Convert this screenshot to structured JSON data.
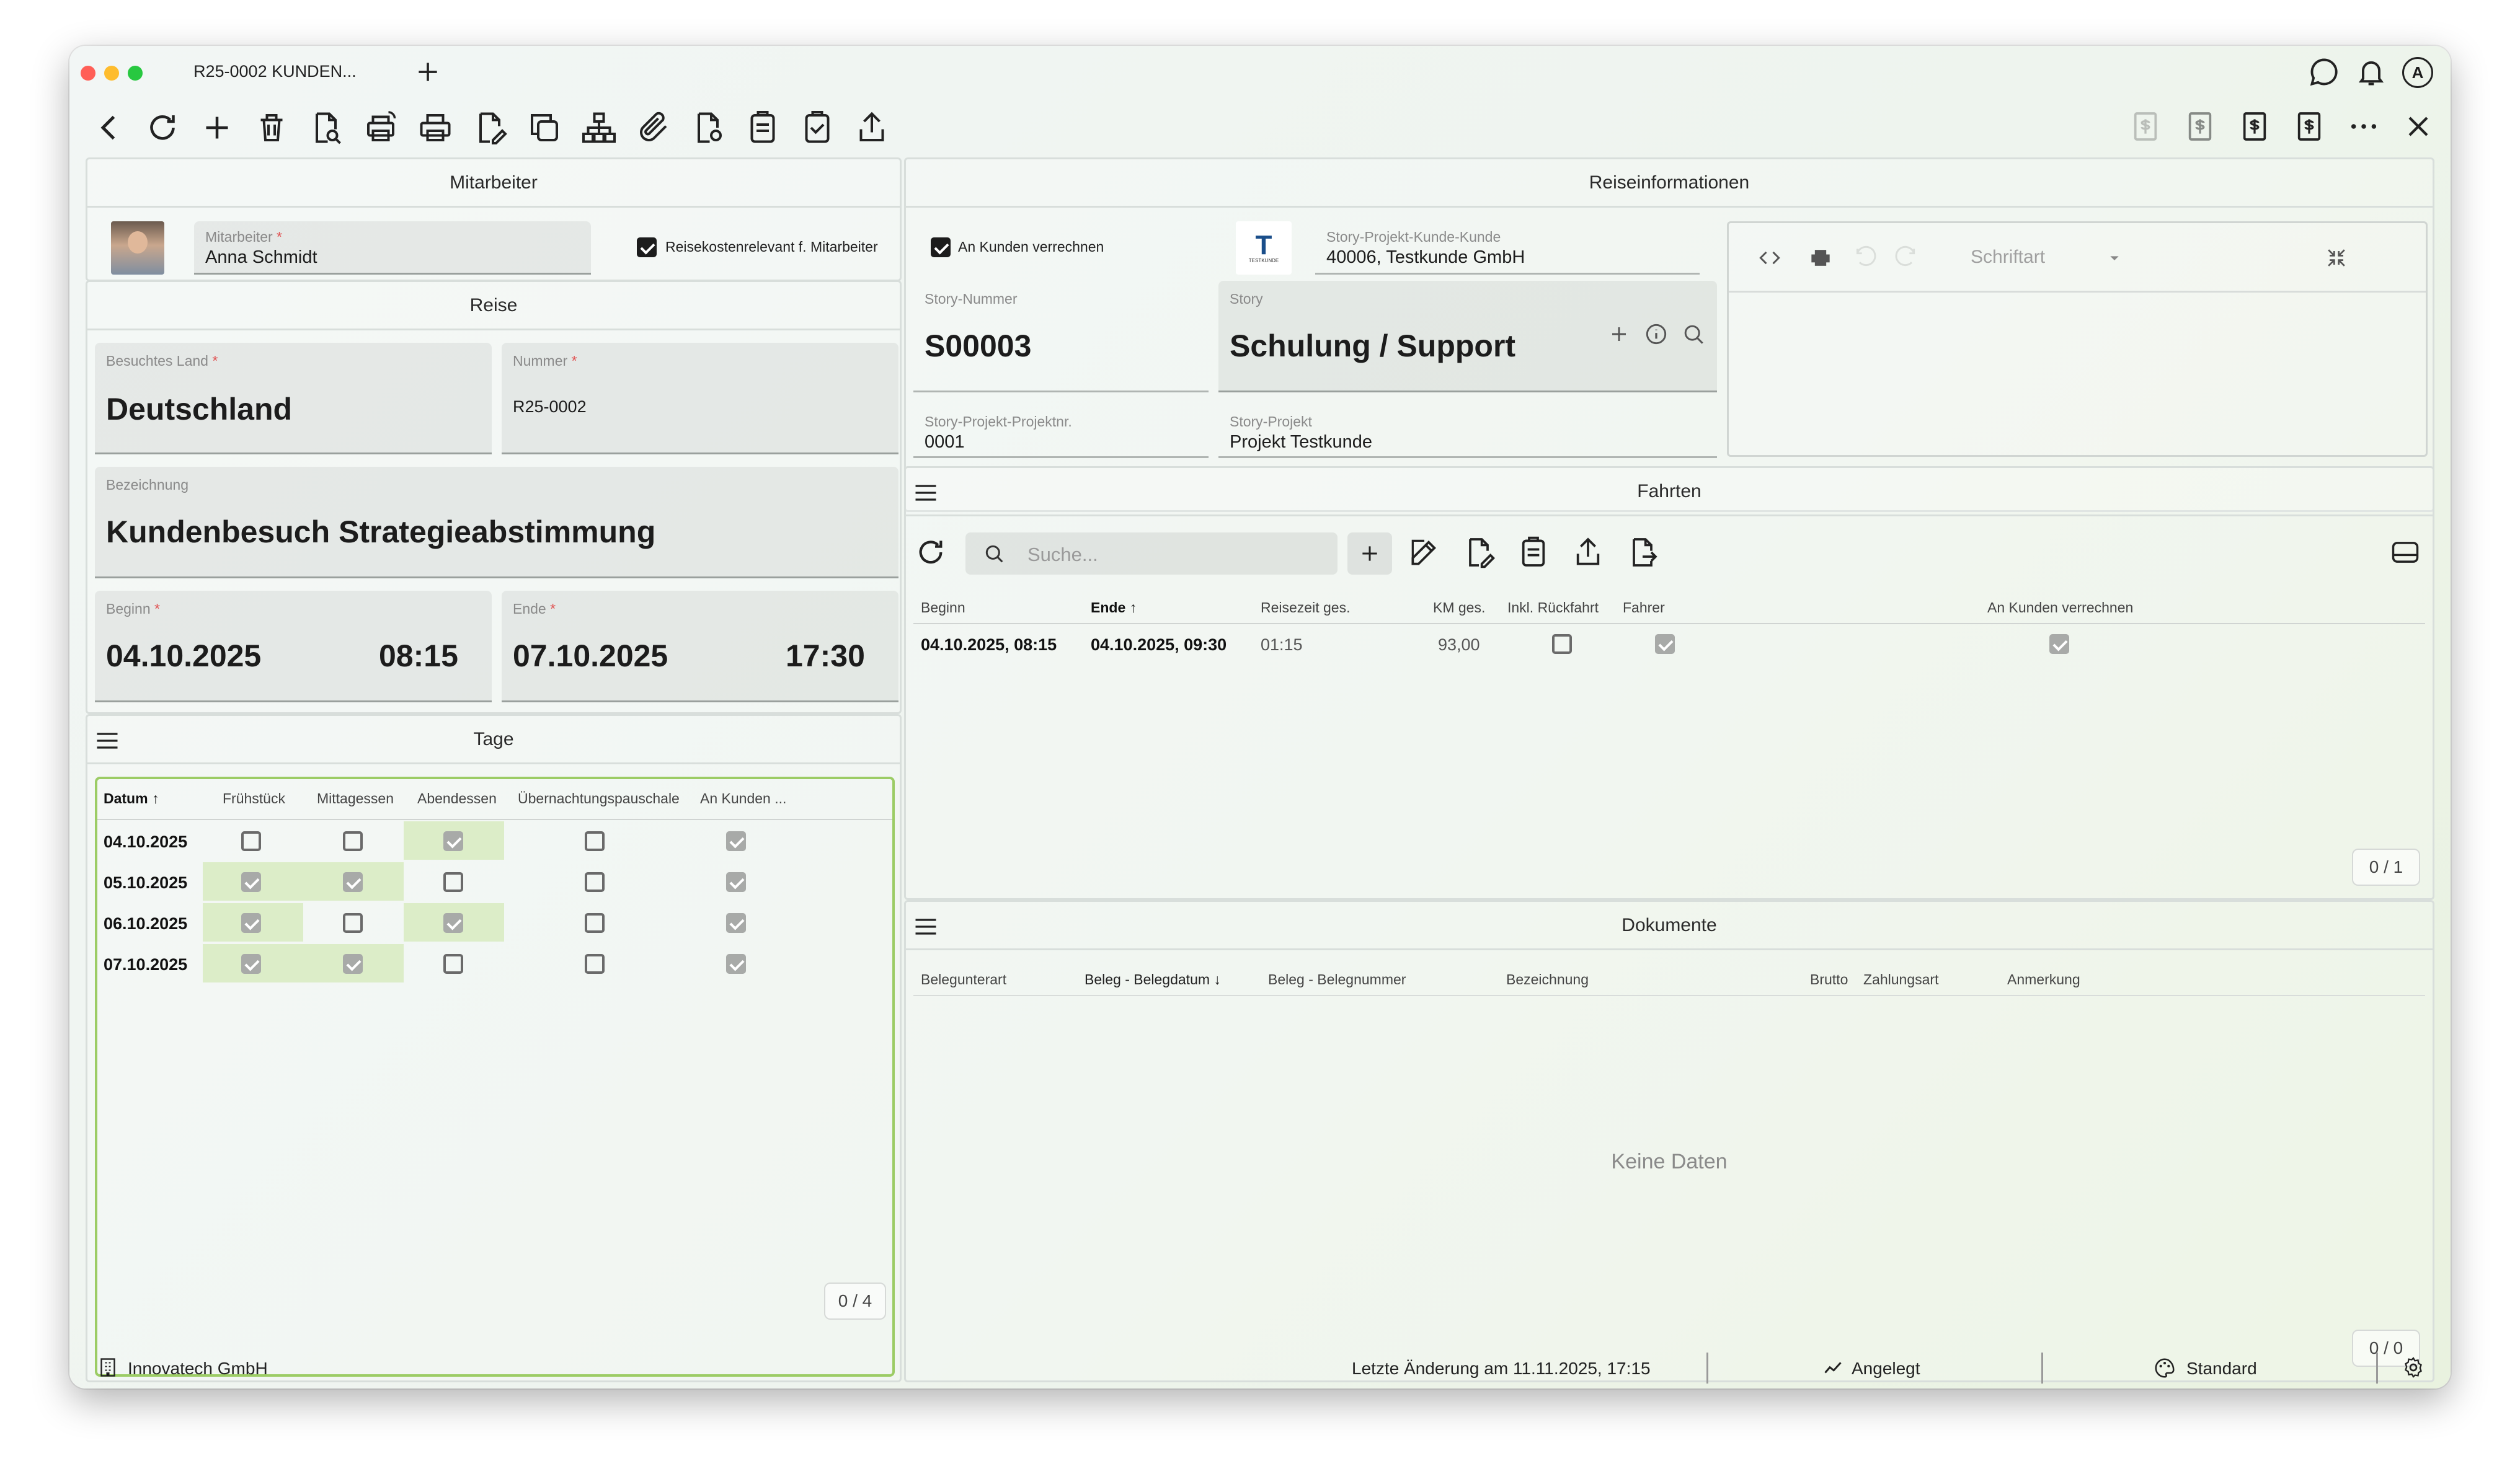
{
  "window": {
    "tab_title": "R25-0002 KUNDEN...",
    "avatar_letter": "A"
  },
  "mitarbeiter": {
    "title": "Mitarbeiter",
    "label": "Mitarbeiter",
    "required_mark": "*",
    "value": "Anna Schmidt",
    "checkbox_label": "Reisekostenrelevant f. Mitarbeiter",
    "checkbox_checked": true
  },
  "reise": {
    "title": "Reise",
    "land_label": "Besuchtes Land",
    "land_value": "Deutschland",
    "nummer_label": "Nummer",
    "nummer_value": "R25-0002",
    "bezeichnung_label": "Bezeichnung",
    "bezeichnung_value": "Kundenbesuch Strategieabstimmung",
    "beginn_label": "Beginn",
    "beginn_date": "04.10.2025",
    "beginn_time": "08:15",
    "ende_label": "Ende",
    "ende_date": "07.10.2025",
    "ende_time": "17:30",
    "required_mark": "*"
  },
  "tage": {
    "title": "Tage",
    "headers": [
      "Datum",
      "Frühstück",
      "Mittagessen",
      "Abendessen",
      "Übernachtungspauschale",
      "An Kunden ..."
    ],
    "sort_arrow": "↑",
    "rows": [
      {
        "datum": "04.10.2025",
        "fruehstueck": false,
        "mittag": false,
        "abend": true,
        "uebernacht": false,
        "kunden": true
      },
      {
        "datum": "05.10.2025",
        "fruehstueck": true,
        "mittag": true,
        "abend": false,
        "uebernacht": false,
        "kunden": true
      },
      {
        "datum": "06.10.2025",
        "fruehstueck": true,
        "mittag": false,
        "abend": true,
        "uebernacht": false,
        "kunden": true
      },
      {
        "datum": "07.10.2025",
        "fruehstueck": true,
        "mittag": true,
        "abend": false,
        "uebernacht": false,
        "kunden": true
      }
    ],
    "pager": "0 / 4"
  },
  "reiseinfo": {
    "title": "Reiseinformationen",
    "verrechnen_label": "An Kunden verrechnen",
    "verrechnen_checked": true,
    "kunde_label": "Story-Projekt-Kunde-Kunde",
    "kunde_value": "40006, Testkunde GmbH",
    "logo_text": "TESTKUNDE",
    "story_nr_label": "Story-Nummer",
    "story_nr_value": "S00003",
    "story_label": "Story",
    "story_value": "Schulung / Support",
    "projektnr_label": "Story-Projekt-Projektnr.",
    "projektnr_value": "0001",
    "projekt_label": "Story-Projekt",
    "projekt_value": "Projekt Testkunde",
    "editor_font_placeholder": "Schriftart"
  },
  "fahrten": {
    "title": "Fahrten",
    "search_placeholder": "Suche...",
    "headers": [
      "Beginn",
      "Ende",
      "Reisezeit ges.",
      "KM ges.",
      "Inkl. Rückfahrt",
      "Fahrer",
      "An Kunden verrechnen"
    ],
    "sort_arrow": "↑",
    "rows": [
      {
        "beginn": "04.10.2025, 08:15",
        "ende": "04.10.2025, 09:30",
        "reisezeit": "01:15",
        "km": "93,00",
        "rueckfahrt": false,
        "fahrer": true,
        "verrechnen": true
      }
    ],
    "pager": "0 / 1"
  },
  "dokumente": {
    "title": "Dokumente",
    "headers": [
      "Belegunterart",
      "Beleg - Belegdatum",
      "Beleg - Belegnummer",
      "Bezeichnung",
      "Brutto",
      "Zahlungsart",
      "Anmerkung"
    ],
    "sort_arrow": "↓",
    "empty": "Keine Daten",
    "pager": "0 / 0"
  },
  "statusbar": {
    "company": "Innovatech GmbH",
    "last_change": "Letzte Änderung am 11.11.2025, 17:15",
    "state": "Angelegt",
    "theme": "Standard"
  },
  "colors": {
    "accent_green": "#8bc34a",
    "green_cell": "#dcedc8",
    "required": "#e05050"
  }
}
